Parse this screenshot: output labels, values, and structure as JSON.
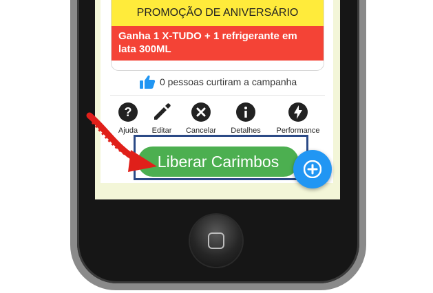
{
  "promo": {
    "title": "PROMOÇÃO DE ANIVERSÁRIO",
    "description": "Ganha 1 X-TUDO + 1 refrigerante em lata 300ML"
  },
  "likes": {
    "text": "0 pessoas curtiram a campanha",
    "icon": "thumbs-up-icon",
    "color": "#2196f3"
  },
  "actions": [
    {
      "label": "Ajuda",
      "icon": "help-icon"
    },
    {
      "label": "Editar",
      "icon": "pencil-icon"
    },
    {
      "label": "Cancelar",
      "icon": "cancel-icon"
    },
    {
      "label": "Detalhes",
      "icon": "info-icon"
    },
    {
      "label": "Performance",
      "icon": "lightning-icon"
    }
  ],
  "cta": {
    "label": "Liberar Carimbos",
    "color": "#4caf50"
  },
  "fab": {
    "icon": "plus-icon",
    "color": "#2196f3"
  },
  "colors": {
    "promo_title_bg": "#ffeb3b",
    "promo_desc_bg": "#f44336",
    "highlight": "#2b4a86",
    "arrow": "#e0201a"
  }
}
